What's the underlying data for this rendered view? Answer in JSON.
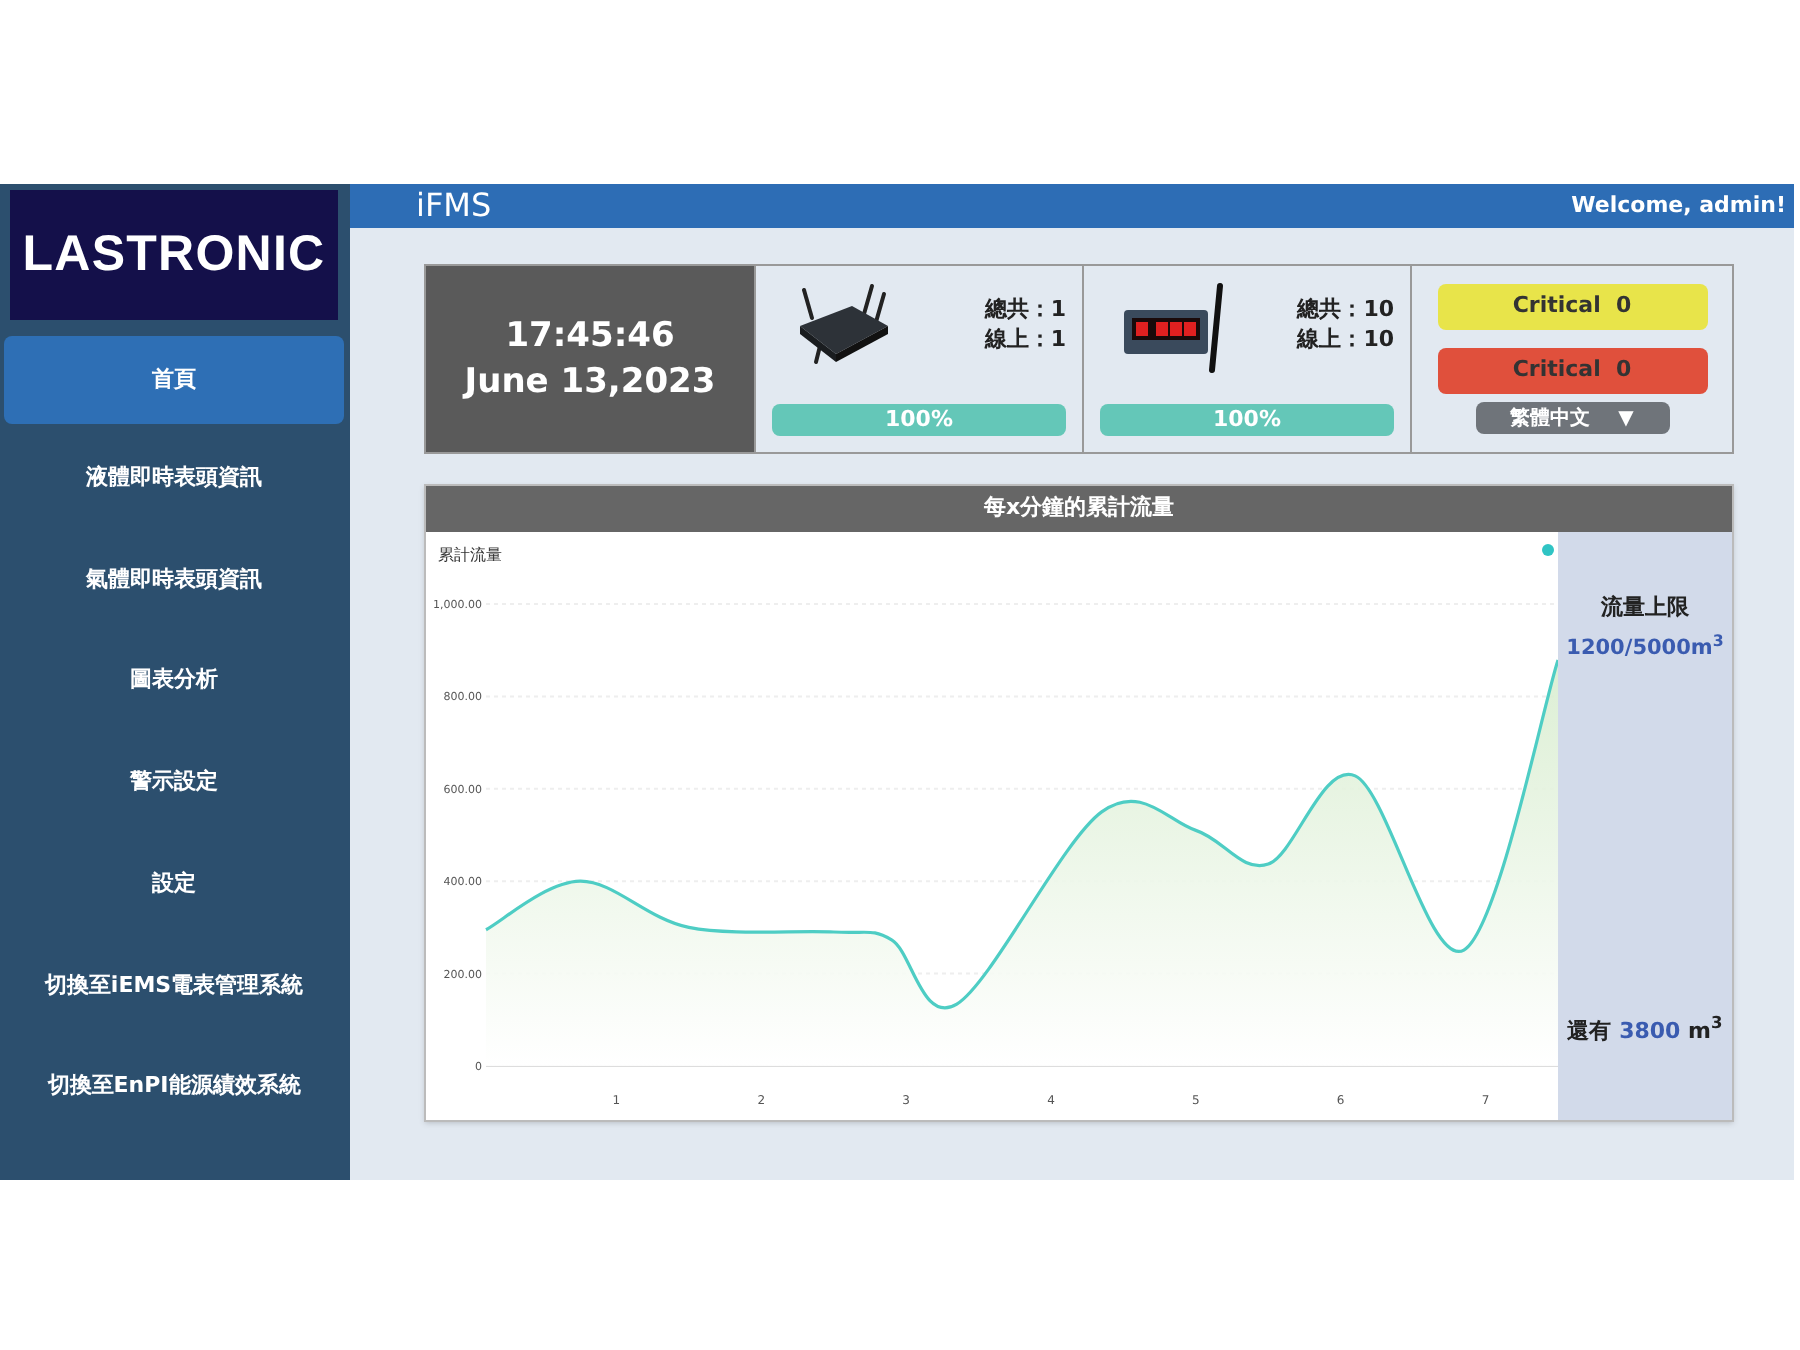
{
  "header": {
    "title": "iFMS",
    "welcome": "Welcome, admin!"
  },
  "sidebar": {
    "logo": "LASTRONIC",
    "items": [
      {
        "label": "首頁",
        "selected": true
      },
      {
        "label": "液體即時表頭資訊",
        "selected": false
      },
      {
        "label": "氣體即時表頭資訊",
        "selected": false
      },
      {
        "label": "圖表分析",
        "selected": false
      },
      {
        "label": "警示設定",
        "selected": false
      },
      {
        "label": "設定",
        "selected": false
      },
      {
        "label": "切換至iEMS電表管理系統",
        "selected": false
      },
      {
        "label": "切換至EnPI能源績效系統",
        "selected": false
      }
    ]
  },
  "clock": {
    "time": "17:45:46",
    "date": "June 13,2023"
  },
  "devices": [
    {
      "kind": "gateway",
      "total": "總共：1",
      "online": "線上：1",
      "level": 1,
      "reading": "100%"
    },
    {
      "kind": "meter",
      "total": "總共：10",
      "online": "線上：10",
      "level": 1,
      "reading": "100%"
    }
  ],
  "alerts": [
    {
      "label": "Critical",
      "count": "0",
      "color": "#e8e44a"
    },
    {
      "label": "Critical",
      "count": "0",
      "color": "#e0503c"
    }
  ],
  "language": {
    "value": "繁體中文",
    "arrow": "▼"
  },
  "flow_panel": {
    "title": "每x分鐘的累計流量",
    "chart_data": {
      "type": "area",
      "ylabel": "累計流量",
      "grid": true,
      "xlim": [
        0.1,
        7.5
      ],
      "x": [
        0.1,
        0.75,
        1.5,
        2.5,
        2.9,
        3.35,
        4.35,
        5.0,
        5.5,
        6.1,
        6.85,
        7.5
      ],
      "series": [
        {
          "color": "#4ecdc4",
          "values": [
            295,
            400,
            300,
            290,
            273,
            134,
            550,
            510,
            437,
            628,
            251,
            879
          ]
        }
      ],
      "xticks": [
        {
          "value": 1,
          "label": "1"
        },
        {
          "value": 2,
          "label": "2"
        },
        {
          "value": 3,
          "label": "3"
        },
        {
          "value": 4,
          "label": "4"
        },
        {
          "value": 5,
          "label": "5"
        },
        {
          "value": 6,
          "label": "6"
        },
        {
          "value": 7,
          "label": "7"
        }
      ],
      "yticks": [
        {
          "value": 0,
          "label": "0"
        },
        {
          "value": 200,
          "label": "200.00"
        },
        {
          "value": 400,
          "label": "400.00"
        },
        {
          "value": 600,
          "label": "600.00"
        },
        {
          "value": 800,
          "label": "800.00"
        },
        {
          "value": 1000,
          "label": "1,000.00"
        }
      ],
      "ylim": [
        0,
        1000
      ]
    },
    "limit_label": "流量上限",
    "limit_value": "1200/5000m$^{3}$",
    "remaining_prefix": "還有",
    "remaining_amount": "3800",
    "remaining_unit": "m$^{3}$"
  }
}
